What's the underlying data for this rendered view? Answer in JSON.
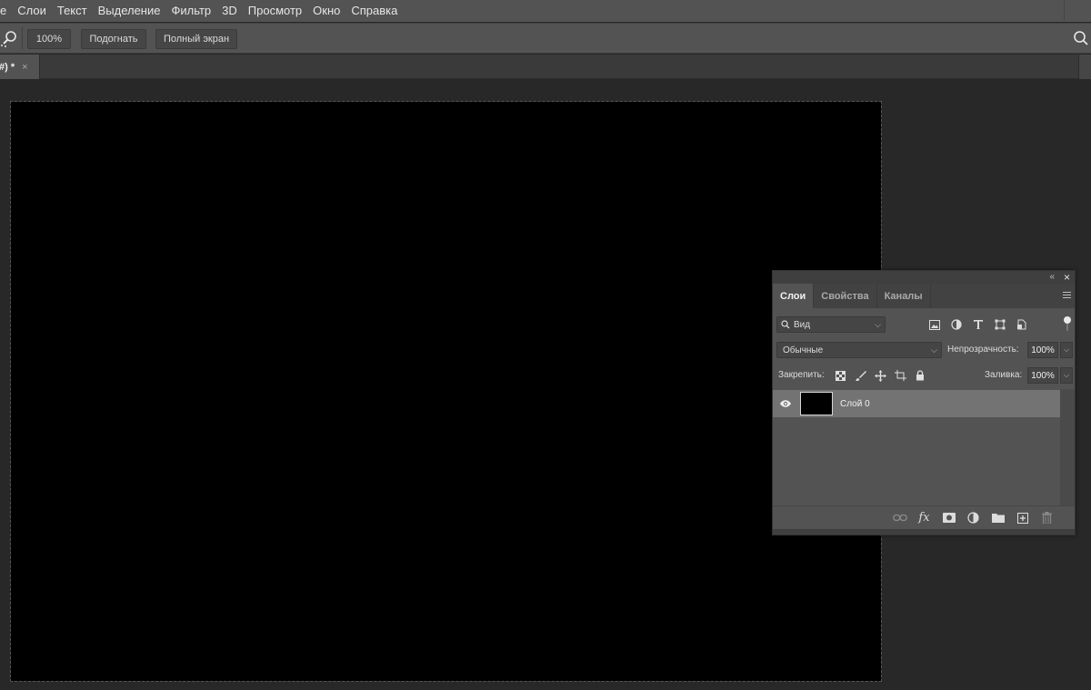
{
  "menubar": {
    "items": [
      "е",
      "Слои",
      "Текст",
      "Выделение",
      "Фильтр",
      "3D",
      "Просмотр",
      "Окно",
      "Справка"
    ]
  },
  "options": {
    "zoom_value": "100%",
    "fit_label": "Подогнать",
    "fullscreen_label": "Полный экран"
  },
  "document": {
    "tab_title": "#) *",
    "tab_close": "×",
    "canvas_color": "#000000"
  },
  "layers_panel": {
    "collapse": "«",
    "close": "×",
    "tabs": [
      "Слои",
      "Свойства",
      "Каналы"
    ],
    "active_tab": "Слои",
    "filter_label": "Вид",
    "blend_mode": "Обычные",
    "opacity_label": "Непрозрачность:",
    "opacity_value": "100%",
    "lock_label": "Закрепить:",
    "fill_label": "Заливка:",
    "fill_value": "100%",
    "layers": [
      {
        "name": "Слой 0",
        "visible": true,
        "selected": true
      }
    ]
  },
  "colors": {
    "menubar": "#535353",
    "workspace": "#282828",
    "panel": "#535353",
    "selected_layer": "#737373"
  }
}
